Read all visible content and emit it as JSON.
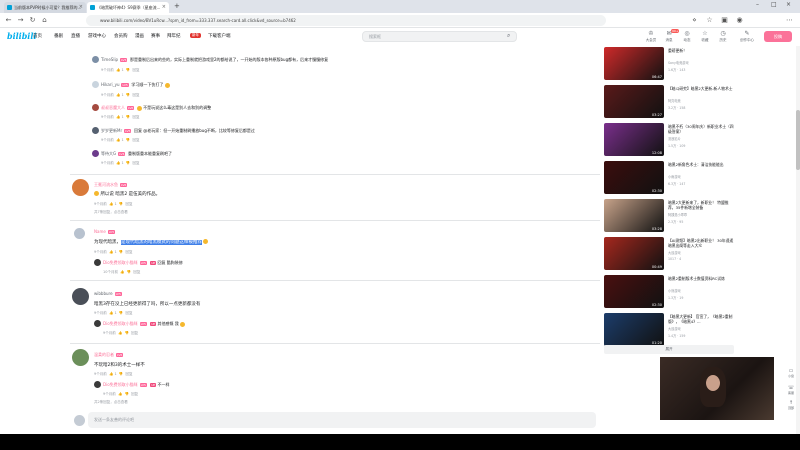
{
  "browser": {
    "tabs": [
      {
        "title": "当前版本PVP时候小可爱？我推荐的...",
        "active": false
      },
      {
        "title": "《暗黑破坏神4》S9赛季（星座流...",
        "active": true
      }
    ],
    "new_tab": "+",
    "url": "www.bilibili.com/video/BV1uRcw...?spm_id_from=333.337.search-card.all.click&vd_source=b7462"
  },
  "header": {
    "logo": "bilibili",
    "nav": [
      "首页",
      "番剧",
      "直播",
      "游戏中心",
      "会员购",
      "漫画",
      "赛事",
      "拜年纪",
      "下载客户端"
    ],
    "nav_badge": "新年",
    "search_placeholder": "搜索框",
    "icons": [
      {
        "label": "大会员",
        "icon": "crown-icon"
      },
      {
        "label": "消息",
        "icon": "message-icon",
        "badge": "99+"
      },
      {
        "label": "动态",
        "icon": "dynamic-icon"
      },
      {
        "label": "收藏",
        "icon": "star-icon"
      },
      {
        "label": "历史",
        "icon": "history-icon"
      },
      {
        "label": "创作中心",
        "icon": "bulb-icon"
      }
    ],
    "upload": "投稿"
  },
  "replies_top": [
    {
      "user": "TimeSlip",
      "text": "那是重制后出来的些的，实际上重制就把游戏里2的都给说了，一开始的版本各种原版bug都有，后来才慢慢修复",
      "time": "9个月前",
      "likes": "1",
      "reply": "回复"
    },
    {
      "user": "Hikari_yu",
      "text": "学习顺一下伤打了",
      "time": "9个月前",
      "likes": "1",
      "reply": "回复"
    },
    {
      "user": "叔叔恶魔大人",
      "text": "不是玩说这么毒这是别人去和别的调整",
      "time": "9个月前",
      "likes": "1",
      "reply": "回复"
    },
    {
      "user": "岁岁更新Mr",
      "text": "回复 @老玩家：但一开始重制刷播放bug不断，比较等修复后都是过",
      "time": "9个月前",
      "likes": "1",
      "reply": "回复"
    },
    {
      "user": "等待大G",
      "text": "重制版重本能重复刷吧了",
      "time": "9个月前",
      "likes": "1",
      "reply": "回复"
    }
  ],
  "comments": [
    {
      "user": "王冕河流水鱼",
      "text": "所以说 暗黑2 是伍美的作品。",
      "time": "9个月前",
      "likes": "1",
      "reply": "回复",
      "footer": "共7条回复，点击查看"
    },
    {
      "user": "Name",
      "text_prefix": "为现代暗黑",
      "text_highlight": "是现代暗黑的暗黑模式的问题这样被推荐",
      "time": "9个月前",
      "likes": "1",
      "reply": "回复",
      "sub_user": "Dio免费领取小猫咪",
      "sub_text": "回复 酷狗装修",
      "sub_time": "10个月前"
    },
    {
      "user": "wibbbure",
      "text": "暗黑3存在没上已经更新得了吗，所以一点更新都没有",
      "time": "9个月前",
      "likes": "1",
      "reply": "回复",
      "sub_user": "Dio免费领取小猫咪",
      "sub_text": "其他感慨 我",
      "sub_time": "9个月前"
    },
    {
      "user": "温柔的忍者",
      "text": "不玩暗2和3的术士一样不",
      "time": "9个月前",
      "likes": "1",
      "reply": "回复",
      "sub_user": "Dio免费领取小猫咪",
      "sub_text": "不一样",
      "sub_time": "9个月前",
      "footer": "共2条回复，点击查看"
    }
  ],
  "comment_box": {
    "placeholder": "发送一条友善的评论吧"
  },
  "sidebar": {
    "recs": [
      {
        "title": "重磅更新！",
        "up": "Sony电竞游戏",
        "stat": "1.6万 · 143",
        "dur": "06:47",
        "thumb": "#cf2a2a"
      },
      {
        "title": "【暗斗研究】暗黑2大更新-新人物术士",
        "up": "阿亮电竞",
        "stat": "3.2万 · 158",
        "dur": "03:27",
        "thumb": "#5a1a1a"
      },
      {
        "title": "暗黑不朽（30周年庆）新职业术士（四级答案）",
        "up": "流浪影片",
        "stat": "1.5万 · 109",
        "dur": "12:08",
        "thumb": "#7a2f8c"
      },
      {
        "title": "暗黑2新角色术士：清洁技能能出",
        "up": "小雨游戏",
        "stat": "6.3万 · 147",
        "dur": "02:30",
        "thumb": "#3b0d0d"
      },
      {
        "title": "暗黑2大更新来了，新职业！ 特盟推荐，35件新增全装备",
        "up": "阿姨是小乖乖",
        "stat": "2.3万 · 95",
        "dur": "03:28",
        "thumb": "#c8a38a"
      },
      {
        "title": "【AI测频】暗黑2出新职业！ 30年遥遥暗黑出阁等走入大众",
        "up": "大遥游戏",
        "stat": "1017 · 4",
        "dur": "00:49",
        "thumb": "#a6281e"
      },
      {
        "title": "暗黑2重制版术士数值资料RC试炼",
        "up": "小熊游戏",
        "stat": "1.3万 · 19",
        "dur": "02:30",
        "thumb": "#4a1010"
      },
      {
        "title": "【暗黑大更新】 官宣了，《暗黑2重制版》，《暗黑4》...",
        "up": "大遥游戏",
        "stat": "1.4万 · 159",
        "dur": "01:20",
        "thumb": "#1c3d6b"
      }
    ],
    "expand": "展开"
  },
  "right_tools": [
    {
      "label": "小窗",
      "icon": "miniwindow-icon"
    },
    {
      "label": "客服",
      "icon": "service-icon"
    },
    {
      "label": "顶部",
      "icon": "top-icon"
    }
  ],
  "colors": {
    "brand": "#00aeec",
    "accent": "#fb7299",
    "highlight": "#3f7fe8"
  }
}
